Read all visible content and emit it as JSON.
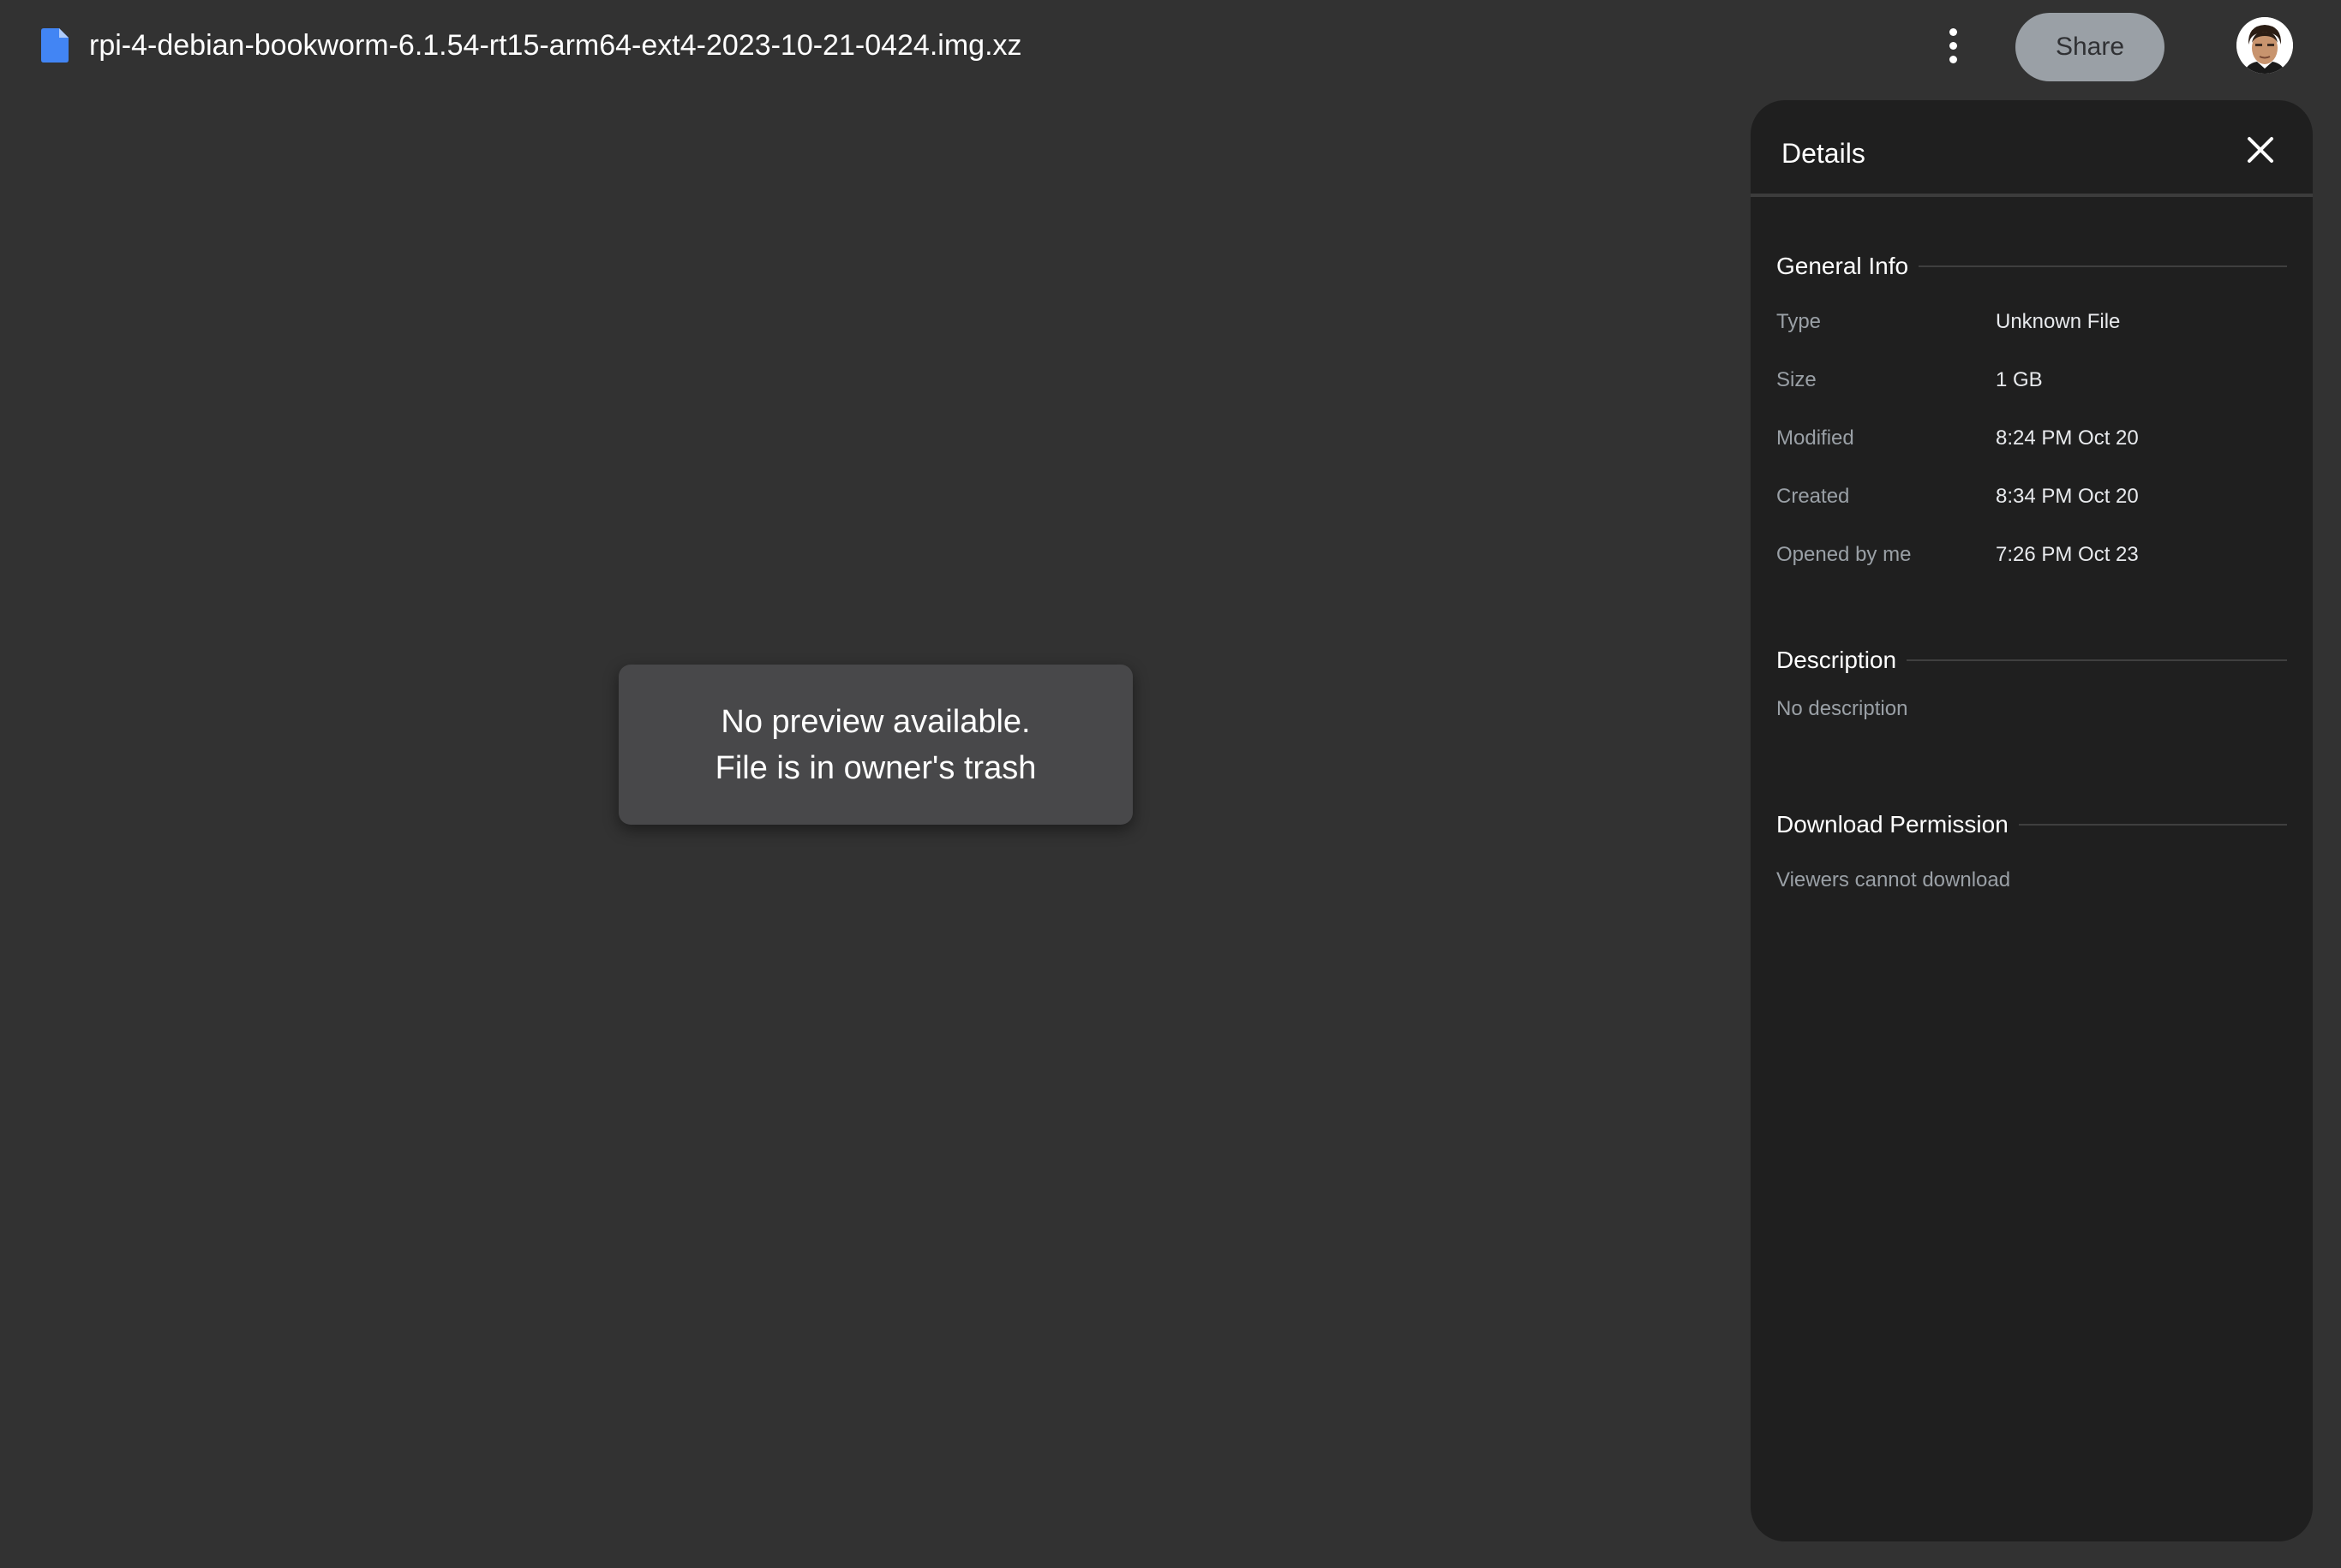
{
  "header": {
    "file_name": "rpi-4-debian-bookworm-6.1.54-rt15-arm64-ext4-2023-10-21-0424.img.xz",
    "share_label": "Share",
    "file_icon": "file-icon",
    "more_icon": "more-vert-icon"
  },
  "preview": {
    "line1": "No preview available.",
    "line2": "File is in owner's trash"
  },
  "details": {
    "title": "Details",
    "close_icon": "close-icon",
    "general_info": {
      "title": "General Info",
      "rows": [
        {
          "label": "Type",
          "value": "Unknown File"
        },
        {
          "label": "Size",
          "value": "1 GB"
        },
        {
          "label": "Modified",
          "value": "8:24 PM Oct 20"
        },
        {
          "label": "Created",
          "value": "8:34 PM Oct 20"
        },
        {
          "label": "Opened by me",
          "value": "7:26 PM Oct 23"
        }
      ]
    },
    "description": {
      "title": "Description",
      "text": "No description"
    },
    "download_permission": {
      "title": "Download Permission",
      "text": "Viewers cannot download"
    }
  },
  "colors": {
    "background": "#323232",
    "panel": "#1f1f1f",
    "share_button": "#9aa0a6",
    "file_icon_blue": "#4285f4"
  }
}
